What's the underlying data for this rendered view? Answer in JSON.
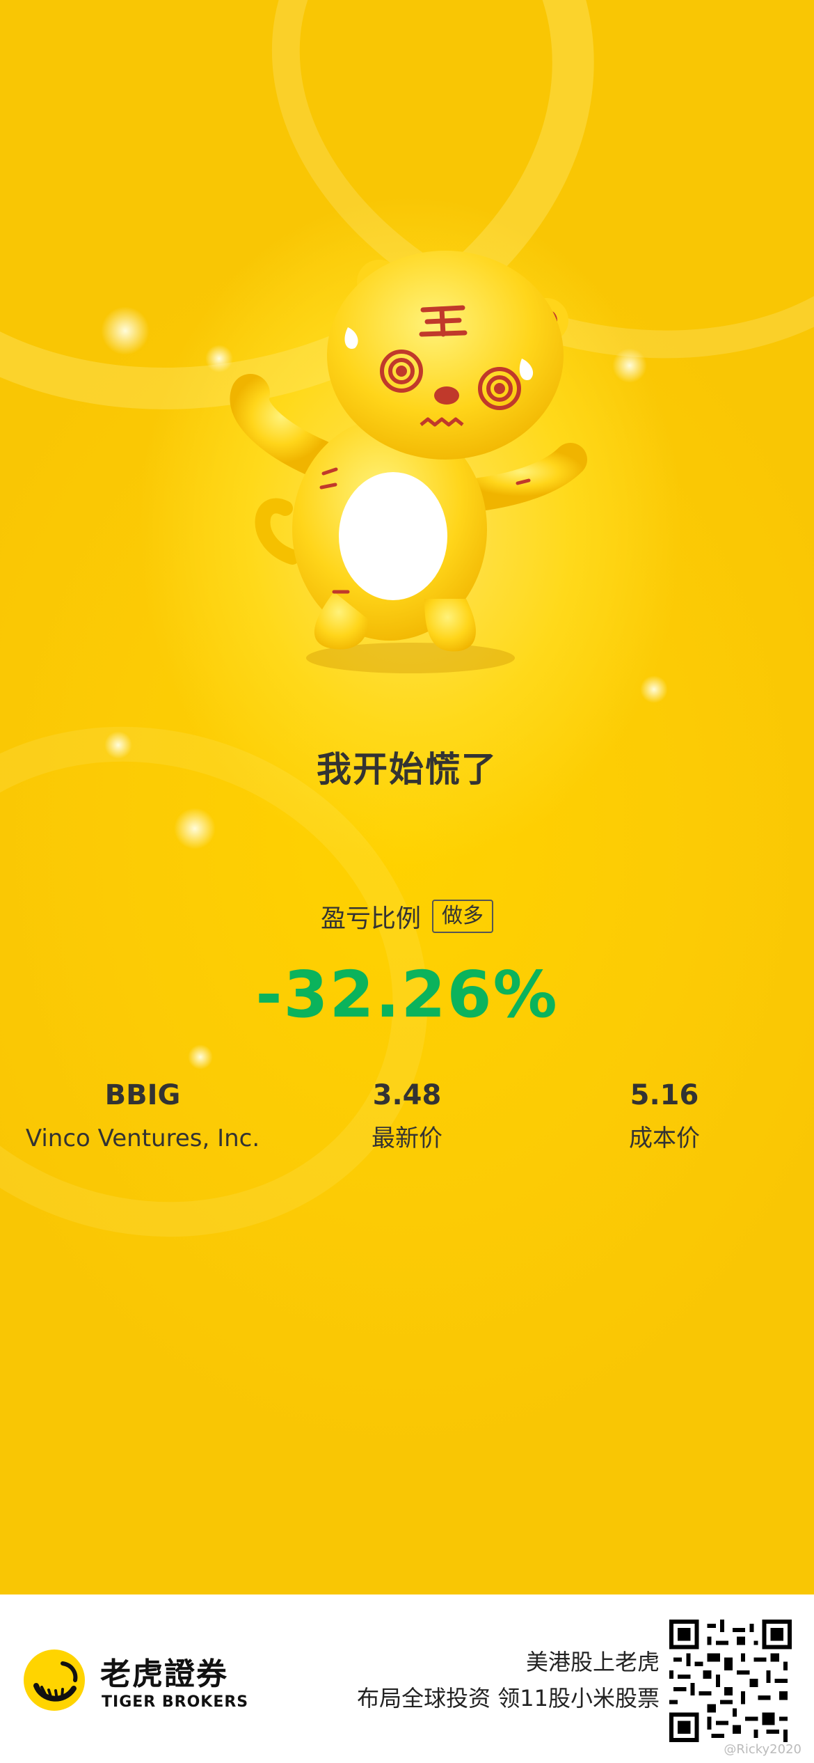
{
  "poster": {
    "mood_text": "我开始慌了",
    "pl_label": "盈亏比例",
    "direction": "做多",
    "pl_value": "-32.26%"
  },
  "stats": {
    "symbol": "BBIG",
    "company": "Vinco Ventures, Inc.",
    "last_price": "3.48",
    "last_price_label": "最新价",
    "cost_price": "5.16",
    "cost_price_label": "成本价"
  },
  "footer": {
    "brand_cn": "老虎證券",
    "brand_en": "TIGER BROKERS",
    "promo_line1": "美港股上老虎",
    "promo_line2": "布局全球投资 领11股小米股票",
    "watermark": "@Ricky2020"
  },
  "colors": {
    "background_yellow": "#fbcc06",
    "loss_green": "#0bb35c",
    "text_dark": "#333333"
  },
  "icons": {
    "mascot": "dizzy-tiger-mascot",
    "logo": "tiger-brokers-logo",
    "qr": "qr-code"
  }
}
